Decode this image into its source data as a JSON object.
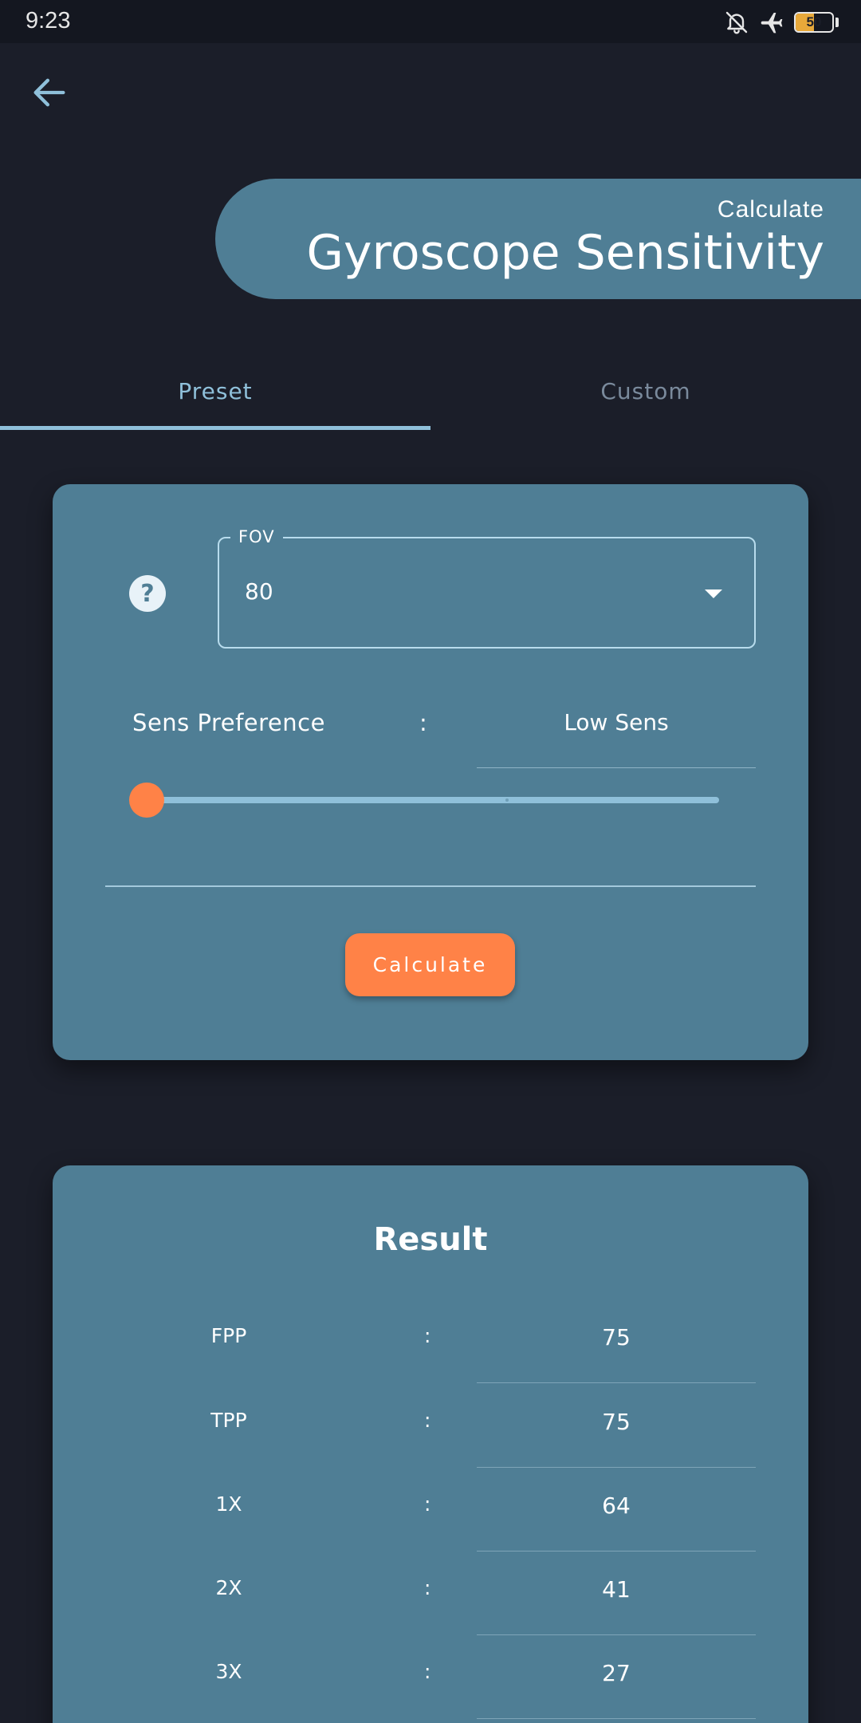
{
  "status_bar": {
    "time": "9:23",
    "icons": [
      "bell-off-icon",
      "airplane-icon",
      "battery-icon"
    ],
    "battery_text": "50",
    "battery_level": 0.5
  },
  "header": {
    "subtitle": "Calculate",
    "title": "Gyroscope Sensitivity"
  },
  "tabs": [
    {
      "label": "Preset",
      "selected": true
    },
    {
      "label": "Custom",
      "selected": false
    }
  ],
  "form": {
    "fov": {
      "label": "FOV",
      "value": "80"
    },
    "preference": {
      "label": "Sens Preference",
      "separator": ":",
      "value": "Low Sens"
    },
    "slider": {
      "value": 0
    },
    "button_label": "Calculate"
  },
  "result": {
    "title": "Result",
    "rows": [
      {
        "label": "FPP",
        "separator": ":",
        "value": "75"
      },
      {
        "label": "TPP",
        "separator": ":",
        "value": "75"
      },
      {
        "label": "1X",
        "separator": ":",
        "value": "64"
      },
      {
        "label": "2X",
        "separator": ":",
        "value": "41"
      },
      {
        "label": "3X",
        "separator": ":",
        "value": "27"
      }
    ]
  },
  "colors": {
    "background": "#1b1e29",
    "card": "#4f7e95",
    "accent": "#ff8247",
    "tab_active": "#8fc0da"
  }
}
